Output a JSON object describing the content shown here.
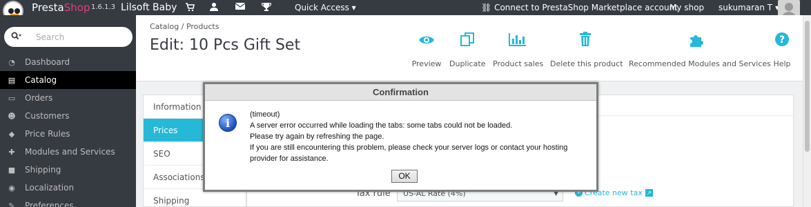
{
  "topbar": {
    "brand_presta": "Presta",
    "brand_shop": "Shop",
    "version": "1.6.1.3",
    "shop_name": "Lilsoft Baby",
    "quick_access": "Quick Access ▾",
    "connect": "Connect to PrestaShop Marketplace account",
    "my_shop": "My shop",
    "user": "sukumaran T ▾"
  },
  "sidebar": {
    "search_placeholder": "Search",
    "items": [
      {
        "label": "Dashboard",
        "icon": "dashboard-icon",
        "glyph": "◔"
      },
      {
        "label": "Catalog",
        "icon": "book-icon",
        "glyph": "▤"
      },
      {
        "label": "Orders",
        "icon": "credit-card-icon",
        "glyph": "▭"
      },
      {
        "label": "Customers",
        "icon": "users-icon",
        "glyph": "☻"
      },
      {
        "label": "Price Rules",
        "icon": "tag-icon",
        "glyph": "◆"
      },
      {
        "label": "Modules and Services",
        "icon": "puzzle-icon",
        "glyph": "✚"
      },
      {
        "label": "Shipping",
        "icon": "truck-icon",
        "glyph": "■"
      },
      {
        "label": "Localization",
        "icon": "globe-icon",
        "glyph": "◉"
      },
      {
        "label": "Preferences",
        "icon": "wrench-icon",
        "glyph": "✎"
      }
    ]
  },
  "header": {
    "breadcrumb": "Catalog  /   Products",
    "title": "Edit: 10 Pcs Gift Set",
    "toolbar": [
      {
        "label": "Preview",
        "icon": "eye-icon",
        "glyph": "◉"
      },
      {
        "label": "Duplicate",
        "icon": "copy-icon",
        "glyph": "❐"
      },
      {
        "label": "Product sales",
        "icon": "bar-chart-icon",
        "glyph": "▥"
      },
      {
        "label": "Delete this product",
        "icon": "trash-icon",
        "glyph": "▥"
      },
      {
        "label": "Recommended Modules and Services",
        "icon": "puzzle-icon",
        "glyph": "✚"
      },
      {
        "label": "Help",
        "icon": "help-icon",
        "glyph": "?"
      }
    ]
  },
  "tabs": [
    "Information",
    "Prices",
    "SEO",
    "Associations",
    "Shipping"
  ],
  "form": {
    "tax_rule_label": "Tax rule",
    "tax_rule_value": "US-AL Rate (4%)",
    "create_tax_link": "Create new tax"
  },
  "dialog": {
    "title": "Confirmation",
    "lines": [
      "(timeout)",
      "A server error occurred while loading the tabs: some tabs could not be loaded.",
      "Please try again by refreshing the page.",
      "If you are still encountering this problem, please check your server logs or contact your hosting",
      "provider for assistance."
    ],
    "ok_label": "OK"
  },
  "colors": {
    "accent": "#25b9d7",
    "dark": "#363a41",
    "brand_pink": "#e0417a"
  }
}
